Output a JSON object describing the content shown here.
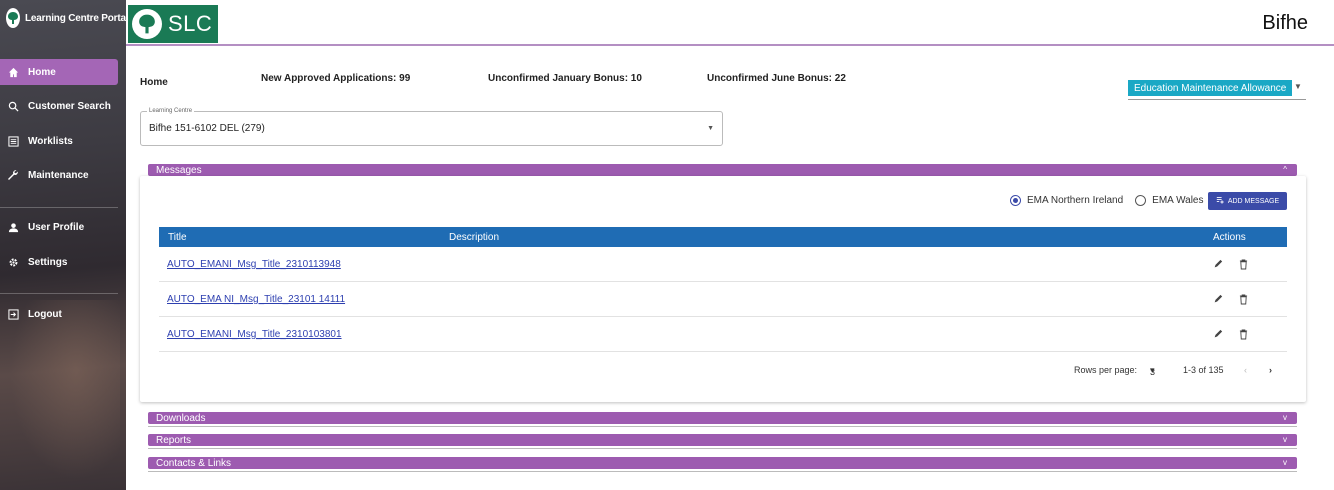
{
  "sidebar": {
    "brand": "Learning Centre Portal",
    "items": [
      {
        "label": "Home"
      },
      {
        "label": "Customer Search"
      },
      {
        "label": "Worklists"
      },
      {
        "label": "Maintenance"
      },
      {
        "label": "User Profile"
      },
      {
        "label": "Settings"
      },
      {
        "label": "Logout"
      }
    ]
  },
  "header": {
    "logo_text": "SLC",
    "user_name": "Bifhe"
  },
  "breadcrumb": "Home",
  "stats": {
    "new_approved": "New Approved Applications: 99",
    "jan_bonus": "Unconfirmed January Bonus: 10",
    "june_bonus": "Unconfirmed June Bonus: 22"
  },
  "ema_select": "Education Maintenance Allowance",
  "learning_centre": {
    "label": "Learning Centre",
    "value": "Bifhe 151-6102 DEL (279)"
  },
  "panels": {
    "messages": "Messages",
    "downloads": "Downloads",
    "reports": "Reports",
    "contacts": "Contacts & Links"
  },
  "messages": {
    "radio_ni": "EMA Northern Ireland",
    "radio_wales": "EMA Wales",
    "add_button": "ADD MESSAGE",
    "columns": {
      "title": "Title",
      "description": "Description",
      "actions": "Actions"
    },
    "rows": [
      {
        "title": "AUTO_EMANI_Msg_Title_2310113948"
      },
      {
        "title": "AUTO_EMA NI_Msg_Title_23101 14111"
      },
      {
        "title": "AUTO_EMANI_Msg_Title_2310103801"
      }
    ],
    "rows_per_page_label": "Rows per page:",
    "rows_per_page_value": "3",
    "range": "1-3 of 135"
  },
  "colors": {
    "accent_purple": "#9d5bb0",
    "slc_green": "#1a7a55",
    "table_header_blue": "#1f6cb4",
    "ema_cyan": "#1aa8c5",
    "button_indigo": "#3b4ba8"
  }
}
